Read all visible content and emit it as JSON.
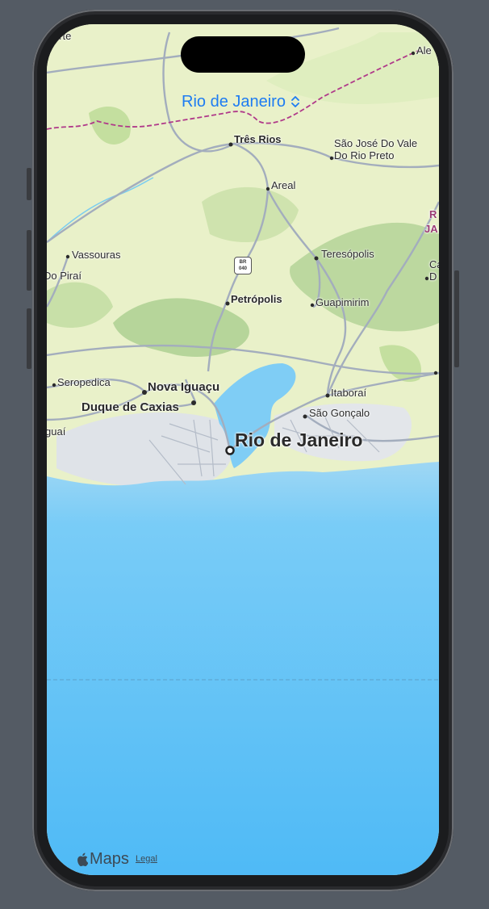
{
  "header": {
    "location_title": "Rio de Janeiro"
  },
  "map": {
    "labels": {
      "tres_rios": "Três Rios",
      "sao_jose": "São José Do Vale",
      "sao_jose_2": "Do Rio Preto",
      "areal": "Areal",
      "vassouras": "Vassouras",
      "pirai": "Do Piraí",
      "teresopolis": "Teresópolis",
      "petropolis": "Petrópolis",
      "guapimirim": "Guapimirim",
      "seropedica": "Seropedica",
      "nova_iguacu": "Nova Iguaçu",
      "duque_de_caxias": "Duque de Caxias",
      "itaborai": "Itaboraí",
      "sao_goncalo": "São Gonçalo",
      "itaguai": "guaí",
      "rio": "Rio de Janeiro",
      "top_left_cut": "arte",
      "top_right_cut": "Ale",
      "right_cut_1": "R",
      "right_cut_2": "JA",
      "right_cut_3": "Ca",
      "right_cut_4": "D"
    },
    "highway_shield": {
      "line1": "BR",
      "line2": "040"
    }
  },
  "footer": {
    "brand": "Maps",
    "legal": "Legal"
  },
  "colors": {
    "accent": "#1e7cf2",
    "water": "#5cc2f7",
    "land": "#e9f1c9"
  }
}
